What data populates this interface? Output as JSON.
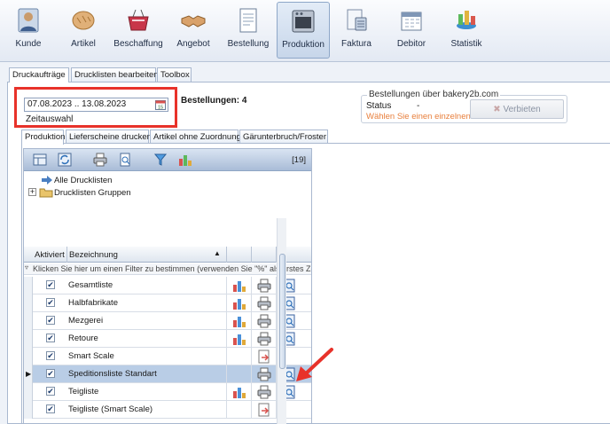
{
  "ribbon": {
    "items": [
      {
        "label": "Kunde",
        "icon": "customer-icon"
      },
      {
        "label": "Artikel",
        "icon": "bread-icon"
      },
      {
        "label": "Beschaffung",
        "icon": "basket-icon"
      },
      {
        "label": "Angebot",
        "icon": "handshake-icon"
      },
      {
        "label": "Bestellung",
        "icon": "order-document-icon"
      },
      {
        "label": "Produktion",
        "icon": "oven-icon"
      },
      {
        "label": "Faktura",
        "icon": "invoice-icon"
      },
      {
        "label": "Debitor",
        "icon": "calendar-icon"
      },
      {
        "label": "Statistik",
        "icon": "statistics-icon"
      }
    ],
    "selected": "Produktion"
  },
  "main_tabs": [
    "Druckaufträge",
    "Drucklisten bearbeiten",
    "Toolbox"
  ],
  "date_range": {
    "value": "07.08.2023 .. 13.08.2023",
    "label": "Zeitauswahl"
  },
  "bestellungen_label": "Bestellungen: 4",
  "bakery_group": {
    "title": "Bestellungen über bakery2b.com",
    "status_label": "Status",
    "status_value": "-",
    "message": "Wählen Sie einen einzelnen Tag",
    "verbieten_label": "Verbieten"
  },
  "sub_tabs": [
    "Produktion",
    "Lieferscheine drucken",
    "Artikel ohne Zuordnung",
    "Gärunterbruch/Froster"
  ],
  "toolbar": {
    "count": "[19]"
  },
  "tree": [
    "Alle Drucklisten",
    "Drucklisten Gruppen"
  ],
  "grid": {
    "headers": {
      "aktiviert": "Aktiviert",
      "bezeichnung": "Bezeichnung"
    },
    "filter_text": "Klicken Sie hier um einen Filter zu bestimmen (verwenden Sie \"%\" als erstes Zeichen)",
    "rows": [
      {
        "name": "Gesamtliste",
        "checked": true,
        "chart": true,
        "print": true,
        "preview": true,
        "export": false,
        "selected": false
      },
      {
        "name": "Halbfabrikate",
        "checked": true,
        "chart": true,
        "print": true,
        "preview": true,
        "export": false,
        "selected": false
      },
      {
        "name": "Mezgerei",
        "checked": true,
        "chart": true,
        "print": true,
        "preview": true,
        "export": false,
        "selected": false
      },
      {
        "name": "Retoure",
        "checked": true,
        "chart": true,
        "print": true,
        "preview": true,
        "export": false,
        "selected": false
      },
      {
        "name": "Smart Scale",
        "checked": true,
        "chart": false,
        "print": false,
        "preview": false,
        "export": true,
        "selected": false
      },
      {
        "name": "Speditionsliste Standart",
        "checked": true,
        "chart": false,
        "print": true,
        "preview": true,
        "export": false,
        "selected": true
      },
      {
        "name": "Teigliste",
        "checked": true,
        "chart": true,
        "print": true,
        "preview": true,
        "export": false,
        "selected": false
      },
      {
        "name": "Teigliste (Smart Scale)",
        "checked": true,
        "chart": false,
        "print": false,
        "preview": false,
        "export": true,
        "selected": false
      }
    ]
  },
  "colors": {
    "highlight_box": "#e8322a",
    "arrow": "#e8322a",
    "selected_row": "#b9cde6",
    "status_message": "#e87f3c"
  }
}
